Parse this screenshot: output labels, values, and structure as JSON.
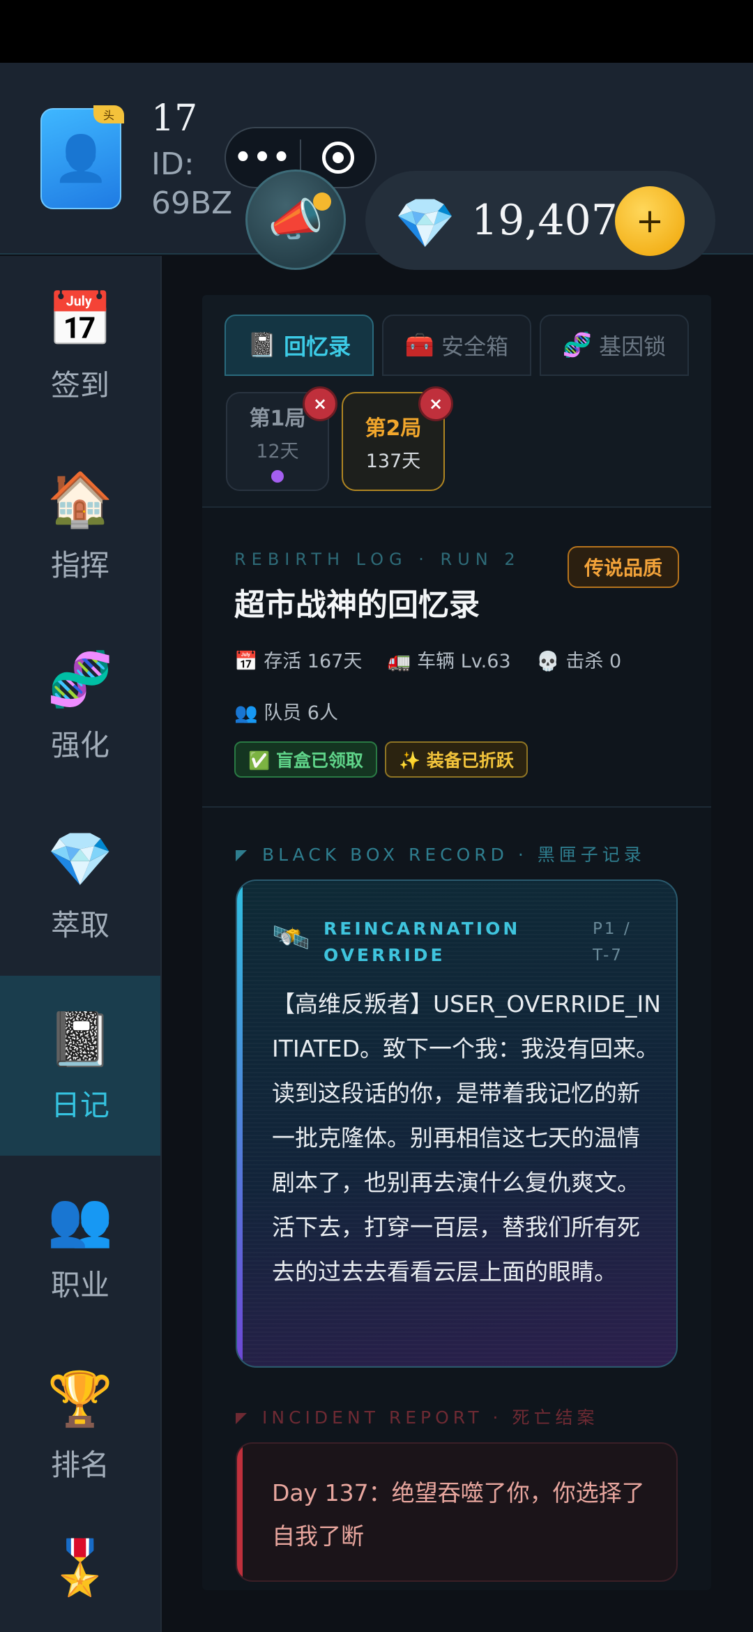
{
  "header": {
    "avatar_badge": "头",
    "level": "17",
    "user_id": "ID: 69BZ",
    "capsule": {
      "more_icon": "•••",
      "close_icon": "target-ring-icon"
    },
    "announce_icon": "📣",
    "gem_icon": "💎",
    "diamonds": "19,407",
    "add_label": "+"
  },
  "sidebar": {
    "items": [
      {
        "icon": "📅",
        "label": "签到"
      },
      {
        "icon": "🏠",
        "label": "指挥"
      },
      {
        "icon": "🧬",
        "label": "强化"
      },
      {
        "icon": "💎",
        "label": "萃取"
      },
      {
        "icon": "📓",
        "label": "日记",
        "active": true
      },
      {
        "icon": "👥",
        "label": "职业"
      },
      {
        "icon": "🏆",
        "label": "排名"
      },
      {
        "icon": "🎖️",
        "label": ""
      }
    ]
  },
  "tabs": [
    {
      "icon": "📓",
      "label": "回忆录",
      "active": true
    },
    {
      "icon": "🧰",
      "label": "安全箱"
    },
    {
      "icon": "🧬",
      "label": "基因锁"
    }
  ],
  "runs": [
    {
      "name": "第1局",
      "days": "12天",
      "close": "×"
    },
    {
      "name": "第2局",
      "days": "137天",
      "close": "×",
      "active": true
    }
  ],
  "summary": {
    "eyebrow": "REBIRTH LOG · RUN 2",
    "rarity": "传说品质",
    "title": "超市战神的回忆录",
    "survive": "📅 存活 167天",
    "vehicle": "🚛 车辆 Lv.63",
    "kills": "💀 击杀 0",
    "members": "👥 队员 6人",
    "chip_blindbox": "✅ 盲盒已领取",
    "chip_equip": "✨ 装备已折跃"
  },
  "blackbox": {
    "heading": "BLACK BOX RECORD · 黑匣子记录",
    "icon": "🛰️",
    "title": "REINCARNATION OVERRIDE",
    "page": "P1 / T-7",
    "text": "【高维反叛者】USER_OVERRIDE_INITIATED。致下一个我：我没有回来。读到这段话的你，是带着我记忆的新一批克隆体。别再相信这七天的温情剧本了，也别再去演什么复仇爽文。活下去，打穿一百层，替我们所有死去的过去去看看云层上面的眼睛。"
  },
  "incident": {
    "heading": "INCIDENT REPORT · 死亡结案",
    "text": "Day 137：绝望吞噬了你，你选择了自我了断"
  }
}
